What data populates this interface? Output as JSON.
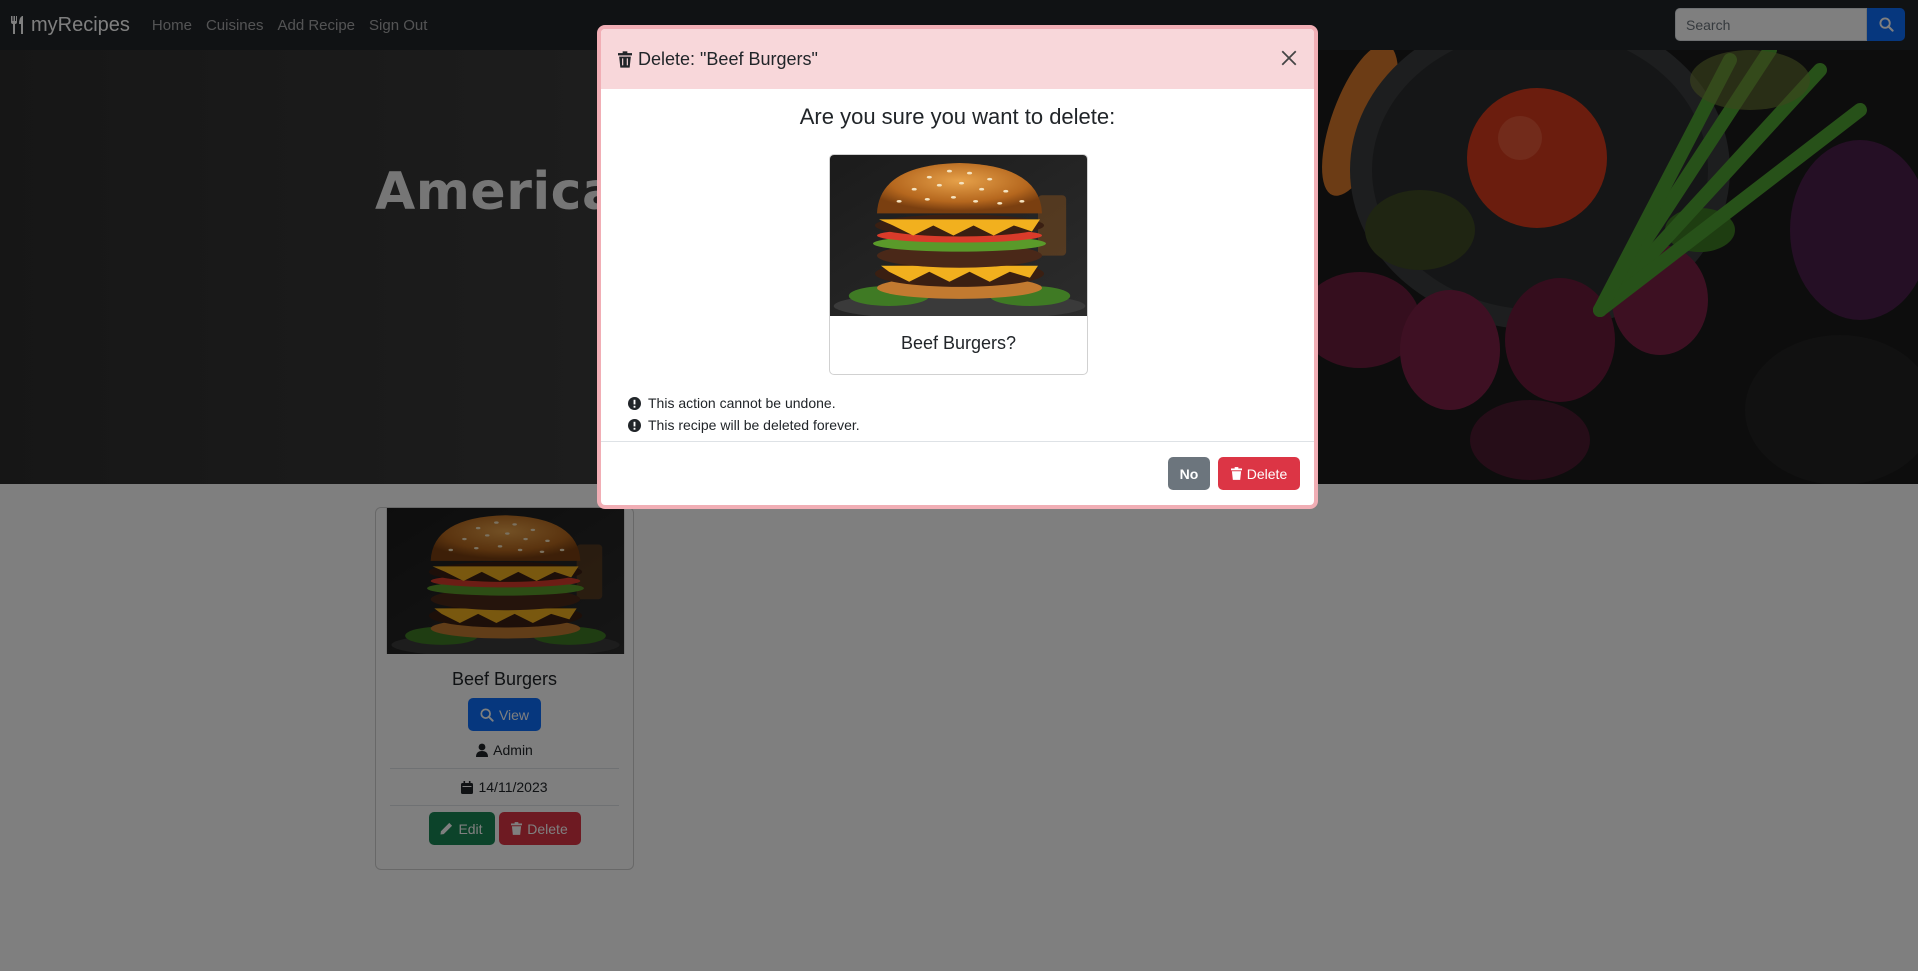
{
  "navbar": {
    "brand": "myRecipes",
    "links": [
      "Home",
      "Cuisines",
      "Add Recipe",
      "Sign Out"
    ],
    "search_placeholder": "Search"
  },
  "hero": {
    "title": "American"
  },
  "recipe_card": {
    "title": "Beef Burgers",
    "view_label": "View",
    "author": "Admin",
    "date": "14/11/2023",
    "edit_label": "Edit",
    "delete_label": "Delete"
  },
  "modal": {
    "title": "Delete: \"Beef Burgers\"",
    "question": "Are you sure you want to delete:",
    "caption": "Beef Burgers?",
    "warnings": [
      "This action cannot be undone.",
      "This recipe will be deleted forever."
    ],
    "no_label": "No",
    "delete_label": "Delete"
  },
  "colors": {
    "navbar_bg": "#212529",
    "primary": "#0d6efd",
    "success": "#198754",
    "danger": "#dc3545",
    "secondary": "#6c757d",
    "modal_header_bg": "#f8d7da",
    "modal_border": "#f1aeb5"
  },
  "icons": {
    "brand": "utensils-icon",
    "search": "search-icon",
    "view": "search-icon",
    "author": "user-icon",
    "date": "calendar-icon",
    "edit": "pencil-icon",
    "delete": "trash-icon",
    "close": "close-icon",
    "warning": "exclamation-circle-icon"
  }
}
